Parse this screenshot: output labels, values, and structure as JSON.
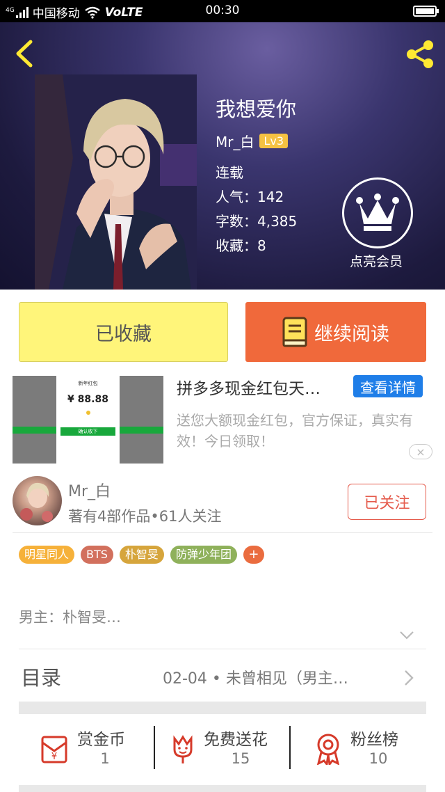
{
  "status_bar": {
    "signal_label": "4G",
    "carrier": "中国移动",
    "network": "VoLTE",
    "time": "00:30"
  },
  "book": {
    "title": "我想爱你",
    "author": "Mr_白",
    "level": "Lv3",
    "status": "连载",
    "popularity": "人气：142",
    "word_count": "字数：4,385",
    "favorites": "收藏：8",
    "vip_label": "点亮会员"
  },
  "actions": {
    "collected_label": "已收藏",
    "continue_label": "继续阅读"
  },
  "ad": {
    "title": "拼多多现金红包天…",
    "detail_button": "查看详情",
    "description": "送您大额现金红包，官方保证，真实有效！今日领取！",
    "card_header": "新年红包",
    "card_amount": "¥ 88.88",
    "card_button": "确认收下",
    "close_icon": "×"
  },
  "author": {
    "name": "Mr_白",
    "info": "著有4部作品•61人关注",
    "follow_label": "已关注"
  },
  "tags": [
    {
      "label": "明星同人",
      "color": "#f6b13a"
    },
    {
      "label": "BTS",
      "color": "#d2705d"
    },
    {
      "label": "朴智旻",
      "color": "#d6a53c"
    },
    {
      "label": "防弹少年团",
      "color": "#8fb15b"
    }
  ],
  "tag_add": "+",
  "intro": "男主：朴智旻…",
  "toc": {
    "label": "目录",
    "latest": "02-04 • 未曾相见（男主…"
  },
  "bottom": {
    "reward": {
      "label": "赏金币",
      "count": "1"
    },
    "flowers": {
      "label": "免费送花",
      "count": "15"
    },
    "fans": {
      "label": "粉丝榜",
      "count": "10"
    }
  },
  "colors": {
    "accent_orange": "#f0693b",
    "collected_yellow": "#fff57a",
    "follow_red": "#e55b4c",
    "detail_blue": "#1f7ee8",
    "icon_yellow": "#ffe933"
  }
}
